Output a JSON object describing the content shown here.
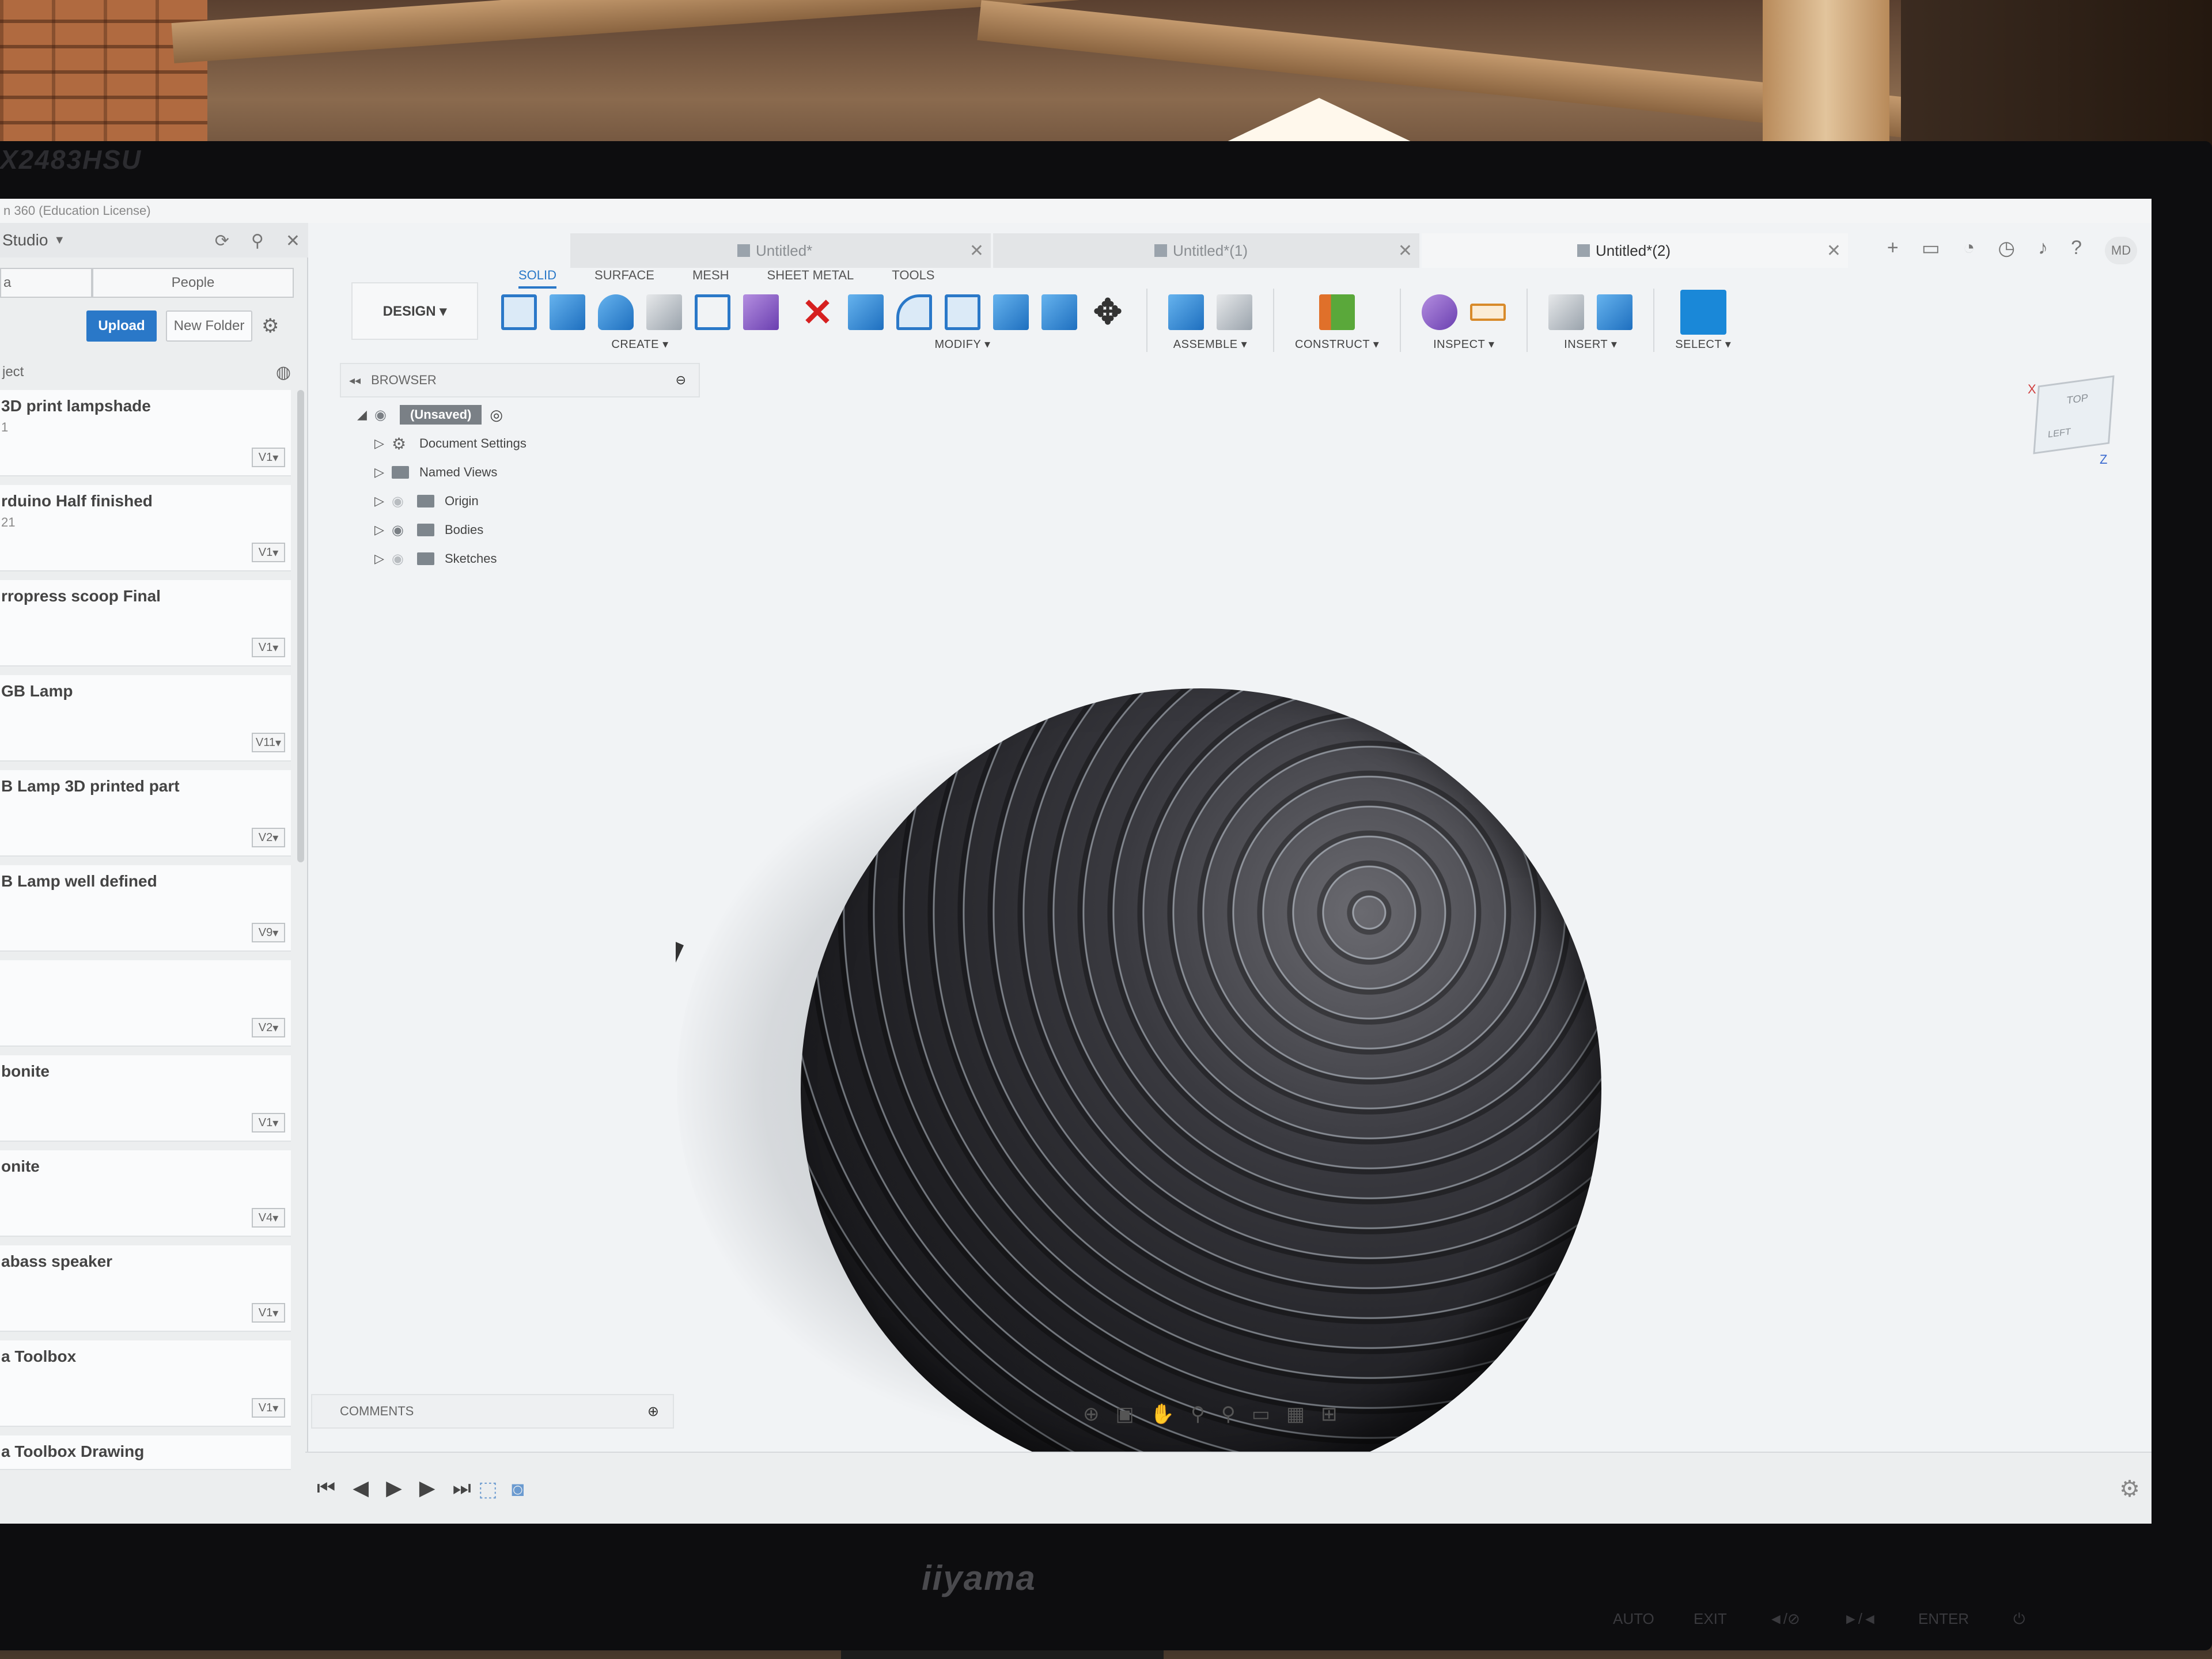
{
  "monitor": {
    "model_text": "X2483HSU",
    "brand": "iiyama",
    "osd_labels": [
      "AUTO",
      "EXIT",
      "◄/⊘",
      "►/◄",
      "ENTER",
      "⏻"
    ]
  },
  "titlebar": {
    "text": "n 360 (Education License)"
  },
  "data_panel": {
    "project": "Studio",
    "tabs": [
      "a",
      "People"
    ],
    "upload_label": "Upload",
    "new_folder_label": "New Folder",
    "section_label": "ject",
    "files": [
      {
        "name": "3D print lampshade",
        "sub": "1",
        "version": "V1"
      },
      {
        "name": "rduino Half finished",
        "sub": "21",
        "version": "V1"
      },
      {
        "name": "rropress scoop Final",
        "sub": "",
        "version": "V1"
      },
      {
        "name": "GB Lamp",
        "sub": "",
        "version": "V11"
      },
      {
        "name": "B Lamp 3D printed part",
        "sub": "",
        "version": "V2"
      },
      {
        "name": "B Lamp well defined",
        "sub": "",
        "version": "V9"
      },
      {
        "name": "",
        "sub": "",
        "version": "V2"
      },
      {
        "name": "bonite",
        "sub": "",
        "version": "V1"
      },
      {
        "name": "onite",
        "sub": "",
        "version": "V4"
      },
      {
        "name": "abass speaker",
        "sub": "",
        "version": "V1"
      },
      {
        "name": "a Toolbox",
        "sub": "",
        "version": "V1"
      },
      {
        "name": "a Toolbox Drawing",
        "sub": "",
        "version": ""
      }
    ]
  },
  "doc_tabs": [
    {
      "label": "Untitled*",
      "active": false
    },
    {
      "label": "Untitled*(1)",
      "active": false
    },
    {
      "label": "Untitled*(2)",
      "active": true
    }
  ],
  "top_right": {
    "avatar": "MD"
  },
  "toolbar": {
    "workspace": "DESIGN ▾",
    "mode_tabs": [
      "SOLID",
      "SURFACE",
      "MESH",
      "SHEET METAL",
      "TOOLS"
    ],
    "groups": {
      "create": "CREATE ▾",
      "modify": "MODIFY ▾",
      "assemble": "ASSEMBLE ▾",
      "construct": "CONSTRUCT ▾",
      "inspect": "INSPECT ▾",
      "insert": "INSERT ▾",
      "select": "SELECT ▾"
    }
  },
  "browser": {
    "title": "BROWSER",
    "root": "(Unsaved)",
    "nodes": [
      "Document Settings",
      "Named Views",
      "Origin",
      "Bodies",
      "Sketches"
    ]
  },
  "viewcube": {
    "top": "TOP",
    "left": "LEFT",
    "x": "X",
    "z": "Z"
  },
  "comments": {
    "label": "COMMENTS"
  },
  "colors": {
    "accent": "#2a78c8",
    "select_button": "#1a88d8",
    "delete_red": "#d62020",
    "sphere_body": "#1e1e22"
  }
}
